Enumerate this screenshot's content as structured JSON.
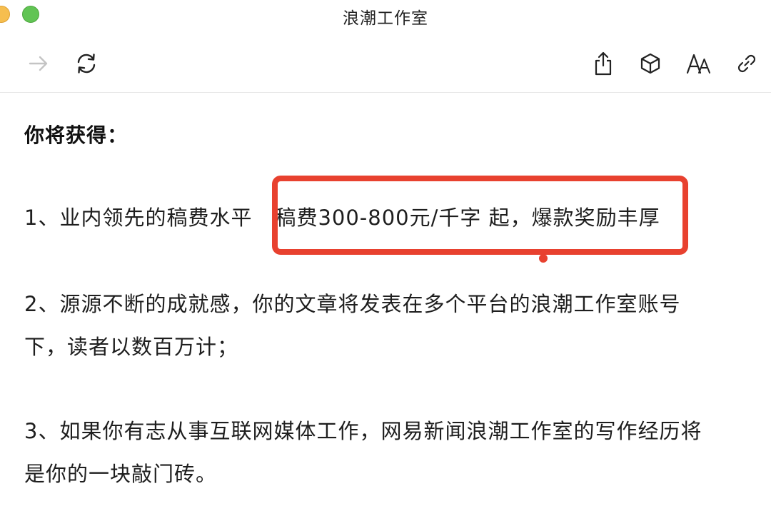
{
  "window": {
    "title": "浪潮工作室"
  },
  "toolbar": {
    "items": [
      {
        "name": "forward-icon"
      },
      {
        "name": "refresh-icon"
      },
      {
        "name": "share-icon"
      },
      {
        "name": "cube-icon"
      },
      {
        "name": "font-size-icon"
      },
      {
        "name": "link-icon"
      }
    ]
  },
  "article": {
    "heading": "你将获得：",
    "item1_prefix": "1、业内领先的稿费水平",
    "item1_highlight": "稿费300-800元/千字 起，爆款奖励丰厚",
    "item2_line1": "2、源源不断的成就感，你的文章将发表在多个平台的浪潮工作室账号",
    "item2_line2": "下，读者以数百万计；",
    "item3_line1": "3、如果你有志从事互联网媒体工作，网易新闻浪潮工作室的写作经历将",
    "item3_line2": "是你的一块敲门砖。"
  },
  "colors": {
    "annotation": "#e8412f",
    "traffic_yellow": "#f6be4f",
    "traffic_green": "#61c454"
  }
}
